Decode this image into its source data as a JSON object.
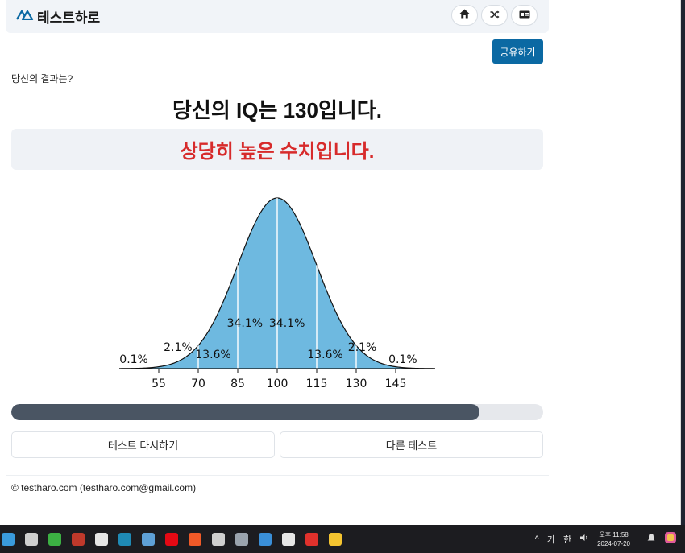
{
  "app": {
    "brand": "테스트하로",
    "accent": "#0b69a3"
  },
  "nav": {
    "icons": [
      "home-icon",
      "shuffle-icon",
      "id-card-icon"
    ]
  },
  "share_label": "공유하기",
  "result": {
    "lead": "당신의 결과는?",
    "headline": "당신의 IQ는 130입니다.",
    "verdict": "상당히 높은 수치입니다.",
    "verdict_color": "#d72b2b"
  },
  "chart_data": {
    "type": "area",
    "x_ticks": [
      "55",
      "70",
      "85",
      "100",
      "115",
      "130",
      "145"
    ],
    "segment_labels": [
      "0.1%",
      "2.1%",
      "13.6%",
      "34.1%",
      "34.1%",
      "13.6%",
      "2.1%",
      "0.1%"
    ],
    "mean": 100,
    "sd": 15,
    "fill": "#6eb9e0"
  },
  "progress": {
    "value_percent": 88
  },
  "buttons": {
    "retry": "테스트 다시하기",
    "other": "다른 테스트"
  },
  "footer": "© testharo.com (testharo.com@gmail.com)",
  "taskbar": {
    "tray": {
      "ime_1": "가",
      "ime_2": "한"
    },
    "time": "오후 11:58",
    "date": "2024-07-20"
  }
}
